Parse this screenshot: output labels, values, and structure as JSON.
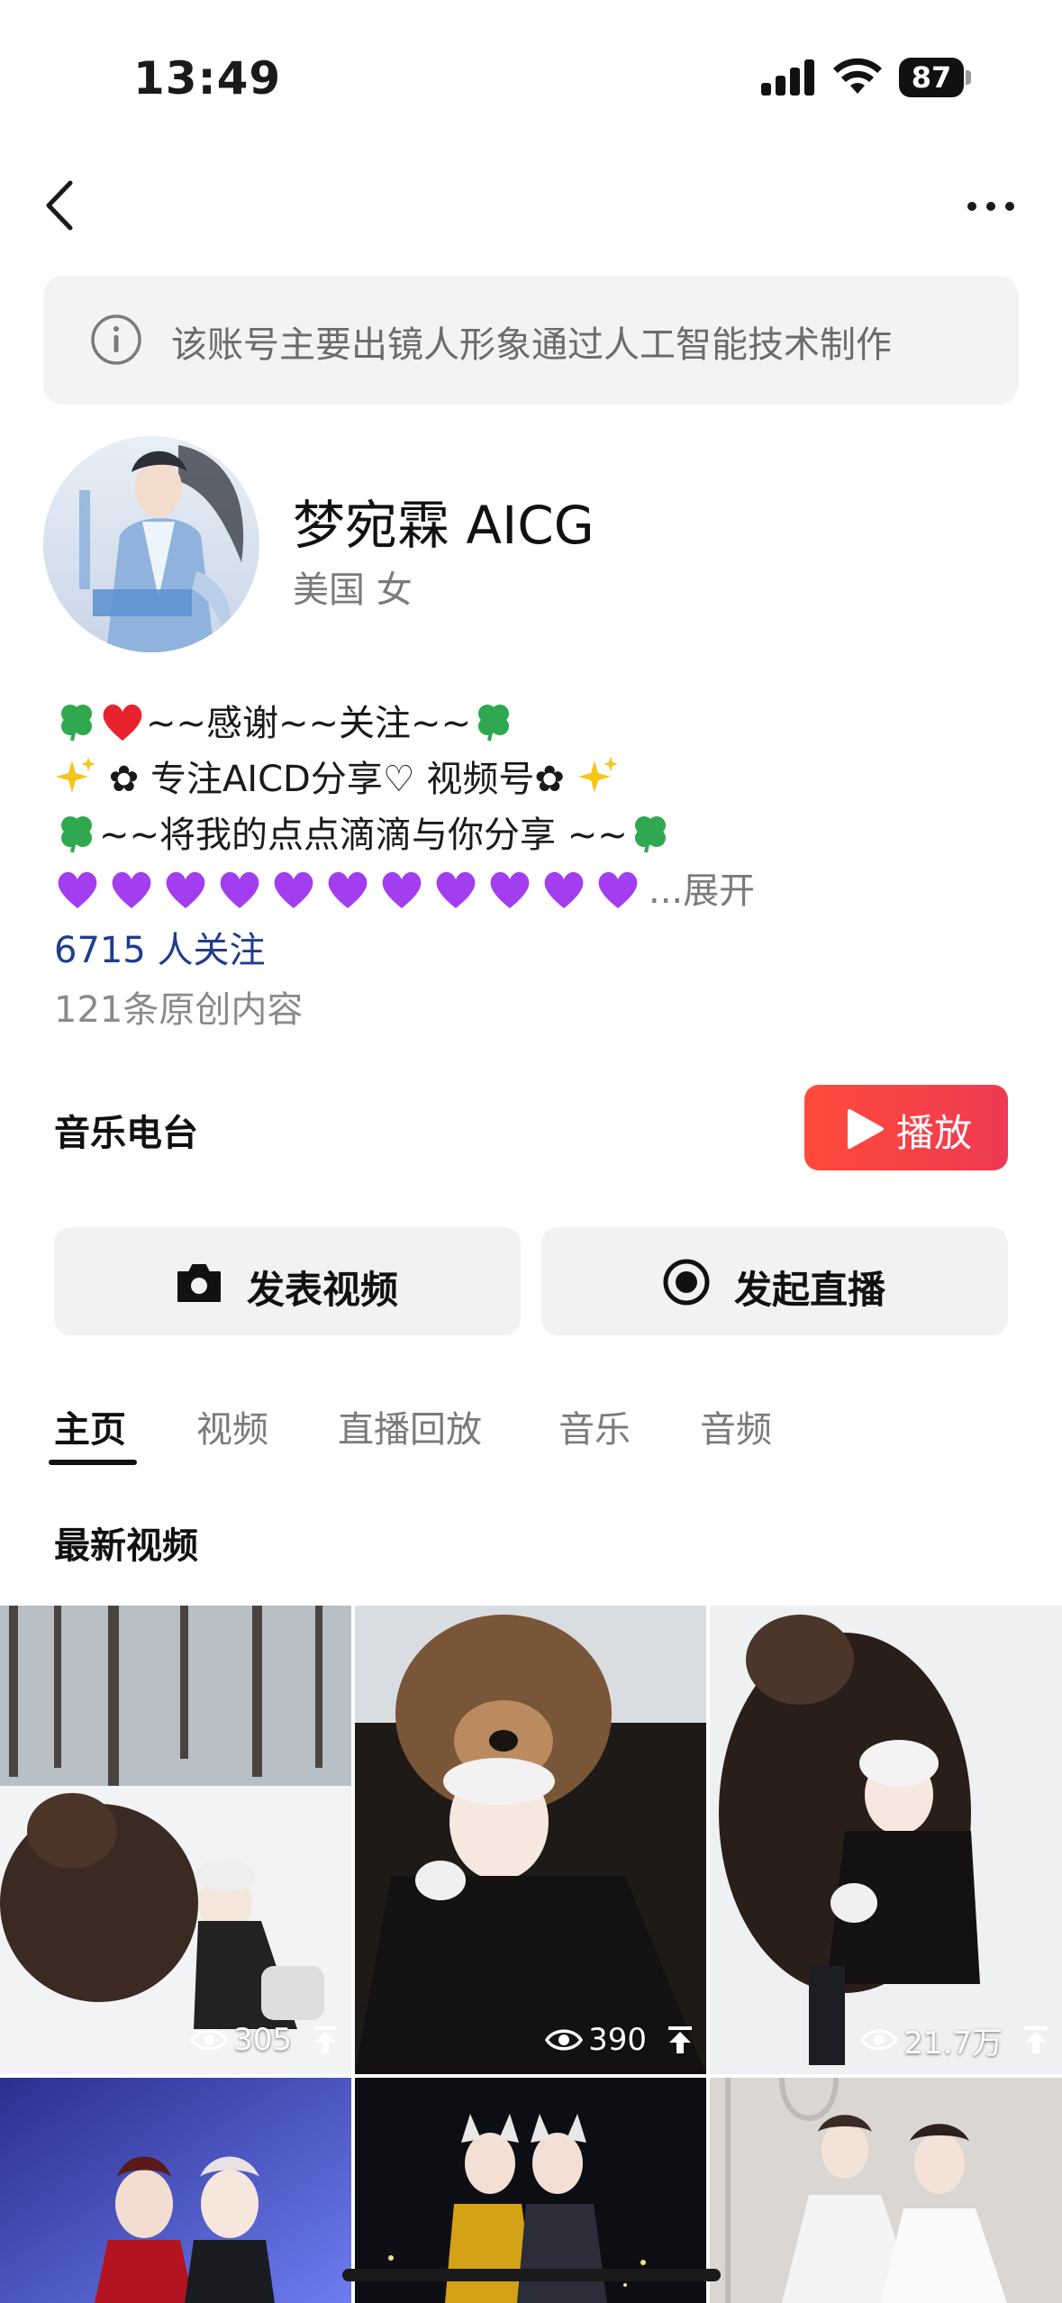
{
  "status_bar": {
    "time": "13:49",
    "battery": "87",
    "icons": [
      "signal-icon",
      "wifi-icon",
      "battery-icon"
    ]
  },
  "nav": {
    "back_icon": "chevron-left-icon",
    "more_icon": "more-dots-icon"
  },
  "ai_notice": {
    "icon": "info-icon",
    "text": "该账号主要出镜人形象通过人工智能技术制作"
  },
  "profile": {
    "name": "梦宛霖 AICG",
    "meta": "美国  女",
    "bio": {
      "line1": "~~感谢~~关注~~",
      "line2": "✿ 专注AICD分享♡ 视频号✿",
      "line3": "~~将我的点点滴滴与你分享 ~~",
      "line4_ellipsis": "...",
      "expand": "展开"
    },
    "followers": "6715 人关注",
    "original_count": "121条原创内容"
  },
  "music": {
    "label": "音乐电台",
    "play_label": "播放"
  },
  "actions": {
    "post_video": "发表视频",
    "go_live": "发起直播"
  },
  "tabs": [
    {
      "label": "主页",
      "active": true
    },
    {
      "label": "视频",
      "active": false
    },
    {
      "label": "直播回放",
      "active": false
    },
    {
      "label": "音乐",
      "active": false
    },
    {
      "label": "音频",
      "active": false
    }
  ],
  "section_title": "最新视频",
  "videos": [
    {
      "views": "305"
    },
    {
      "views": "390"
    },
    {
      "views": "21.7万"
    }
  ],
  "colors": {
    "accent_red": "#ff4b3a",
    "link_blue": "#1f3d8c",
    "heart_purple": "#a33df0"
  }
}
